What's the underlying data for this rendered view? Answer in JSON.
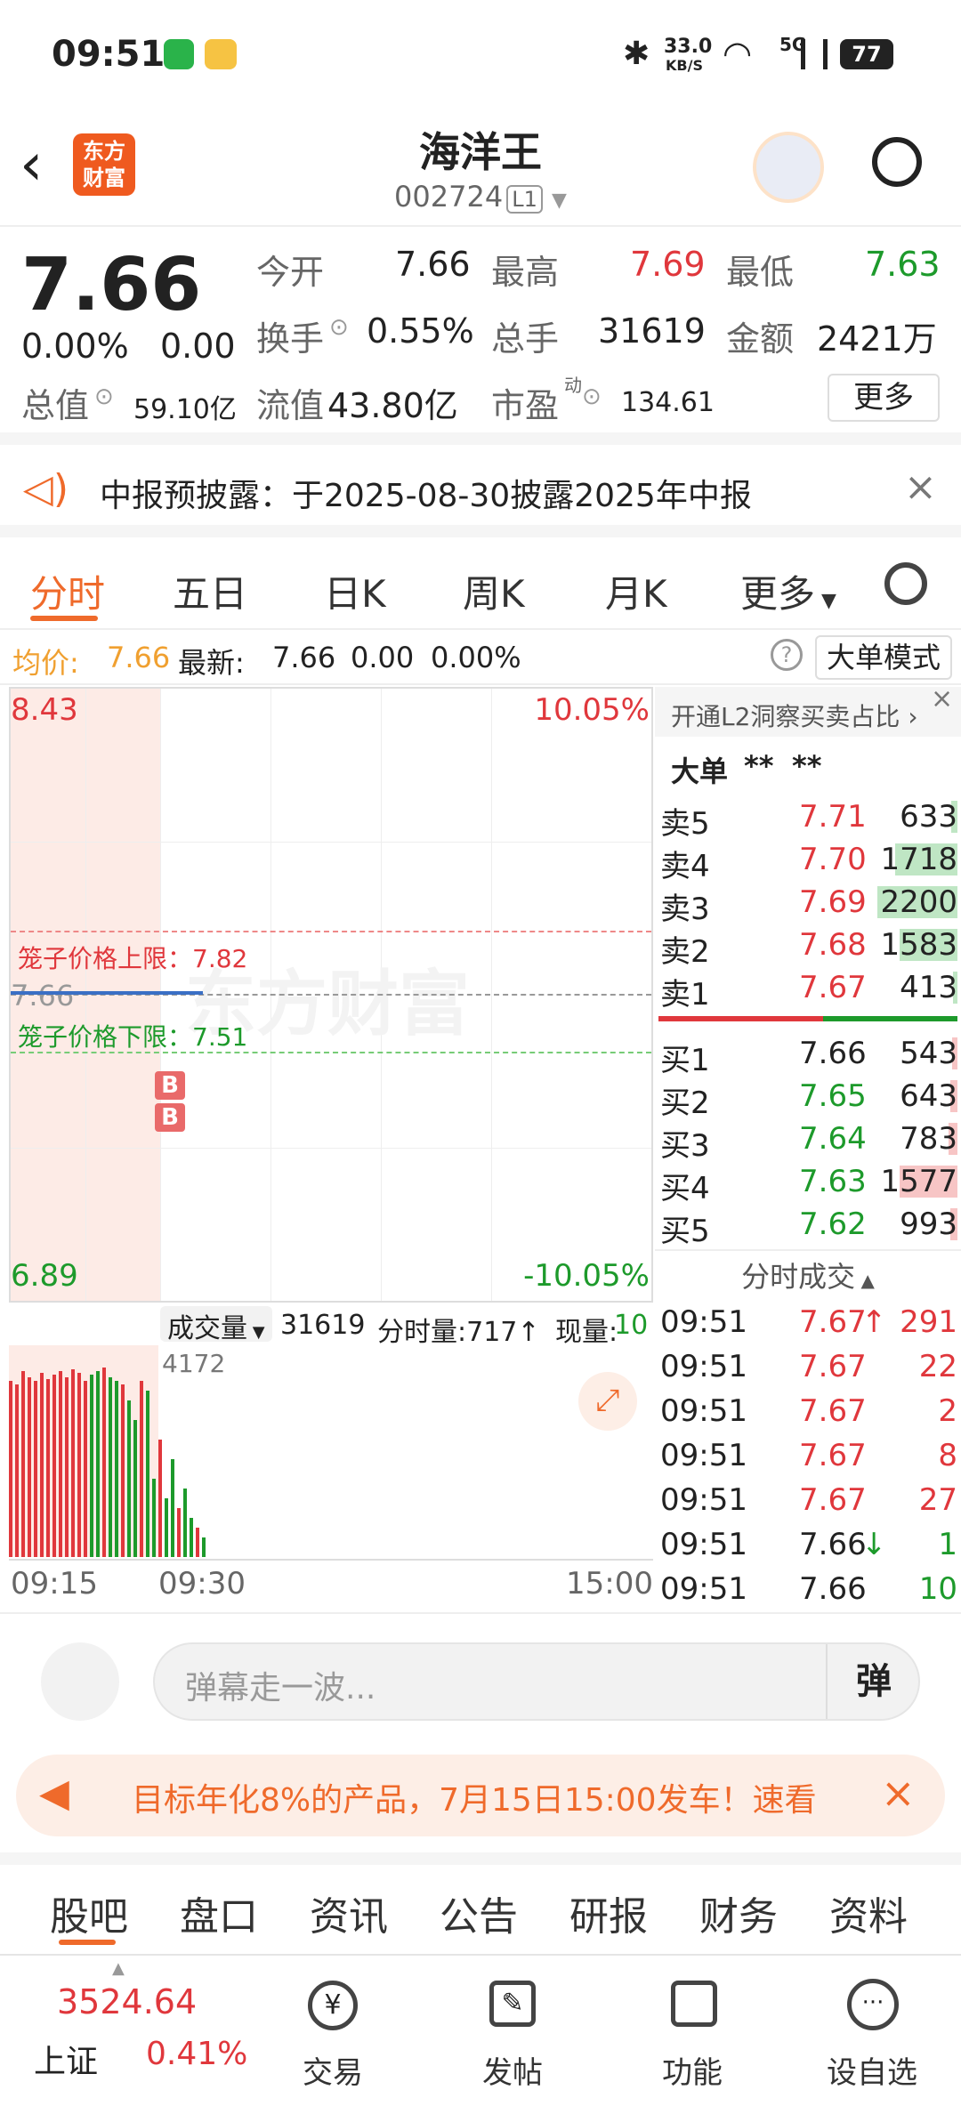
{
  "status_bar": {
    "time": "09:51",
    "net_speed": "33.0",
    "net_unit": "KB/S",
    "network": "5G",
    "battery": "77"
  },
  "header": {
    "logo_text": "东方财富",
    "title": "海洋王",
    "code": "002724",
    "level": "L1"
  },
  "quote": {
    "price": "7.66",
    "change_pct": "0.00%",
    "change": "0.00",
    "open_label": "今开",
    "open": "7.66",
    "high_label": "最高",
    "high": "7.69",
    "low_label": "最低",
    "low": "7.63",
    "turnover_label": "换手",
    "turnover": "0.55%",
    "volume_label": "总手",
    "volume": "31619",
    "amount_label": "金额",
    "amount": "2421万",
    "mktcap_label": "总值",
    "mktcap": "59.10亿",
    "float_label": "流值",
    "float": "43.80亿",
    "pe_label": "市盈",
    "pe_sup": "动",
    "pe": "134.61",
    "more_label": "更多"
  },
  "notice": {
    "text": "中报预披露：于2025-08-30披露2025年中报"
  },
  "tabs": [
    "分时",
    "五日",
    "日K",
    "周K",
    "月K",
    "更多"
  ],
  "info": {
    "avg_label": "均价:",
    "avg": "7.66",
    "latest_label": "最新:",
    "latest": "7.66",
    "chg": "0.00",
    "chg_pct": "0.00%",
    "mode": "大单模式"
  },
  "chart": {
    "top_price": "8.43",
    "top_pct": "10.05%",
    "bottom_price": "6.89",
    "bottom_pct": "-10.05%",
    "mid_price": "7.66",
    "upper_limit_label": "笼子价格上限：7.82",
    "lower_limit_label": "笼子价格下限：7.51",
    "watermark": "东方财富",
    "marker_b1": "B",
    "marker_b2": "B"
  },
  "volume_bar": {
    "selector": "成交量",
    "total": "31619",
    "period_label": "分时量:717",
    "now_label": "现量:",
    "now": "10",
    "max": "4172"
  },
  "time_axis": [
    "09:15",
    "09:30",
    "15:00"
  ],
  "orderbook": {
    "l2_link": "开通L2洞察买卖占比",
    "bigorder_label": "大单",
    "bigorder_v1": "**",
    "bigorder_v2": "**",
    "asks": [
      {
        "label": "卖5",
        "price": "7.71",
        "vol": "633",
        "bar": 0.08
      },
      {
        "label": "卖4",
        "price": "7.70",
        "vol": "1718",
        "bar": 0.78
      },
      {
        "label": "卖3",
        "price": "7.69",
        "vol": "2200",
        "bar": 1.0
      },
      {
        "label": "卖2",
        "price": "7.68",
        "vol": "1583",
        "bar": 0.72
      },
      {
        "label": "卖1",
        "price": "7.67",
        "vol": "413",
        "bar": 0.05
      }
    ],
    "bids": [
      {
        "label": "买1",
        "price": "7.66",
        "vol": "543",
        "bar": 0.07
      },
      {
        "label": "买2",
        "price": "7.65",
        "vol": "643",
        "bar": 0.09
      },
      {
        "label": "买3",
        "price": "7.64",
        "vol": "783",
        "bar": 0.11
      },
      {
        "label": "买4",
        "price": "7.63",
        "vol": "1577",
        "bar": 0.72
      },
      {
        "label": "买5",
        "price": "7.62",
        "vol": "993",
        "bar": 0.09
      }
    ],
    "trades_title": "分时成交",
    "trades": [
      {
        "time": "09:51",
        "price": "7.67",
        "arrow": "↑",
        "vol": "291",
        "color": "red"
      },
      {
        "time": "09:51",
        "price": "7.67",
        "arrow": "",
        "vol": "22",
        "color": "red"
      },
      {
        "time": "09:51",
        "price": "7.67",
        "arrow": "",
        "vol": "2",
        "color": "red"
      },
      {
        "time": "09:51",
        "price": "7.67",
        "arrow": "",
        "vol": "8",
        "color": "red"
      },
      {
        "time": "09:51",
        "price": "7.67",
        "arrow": "",
        "vol": "27",
        "color": "red"
      },
      {
        "time": "09:51",
        "price": "7.66",
        "arrow": "↓",
        "vol": "1",
        "color": "green"
      },
      {
        "time": "09:51",
        "price": "7.66",
        "arrow": "",
        "vol": "10",
        "color": "green"
      }
    ]
  },
  "danmu": {
    "placeholder": "弹幕走一波...",
    "send": "弹"
  },
  "banner": {
    "text": "目标年化8%的产品，7月15日15:00发车！速看"
  },
  "bottom_tabs": [
    "股吧",
    "盘口",
    "资讯",
    "公告",
    "研报",
    "财务",
    "资料"
  ],
  "nav": {
    "index_name": "上证",
    "index_value": "3524.64",
    "index_pct": "0.41%",
    "items": [
      "交易",
      "发帖",
      "功能",
      "设自选"
    ]
  },
  "colors": {
    "accent": "#ef6a2b",
    "up": "#e0373c",
    "down": "#1d9a2b"
  }
}
